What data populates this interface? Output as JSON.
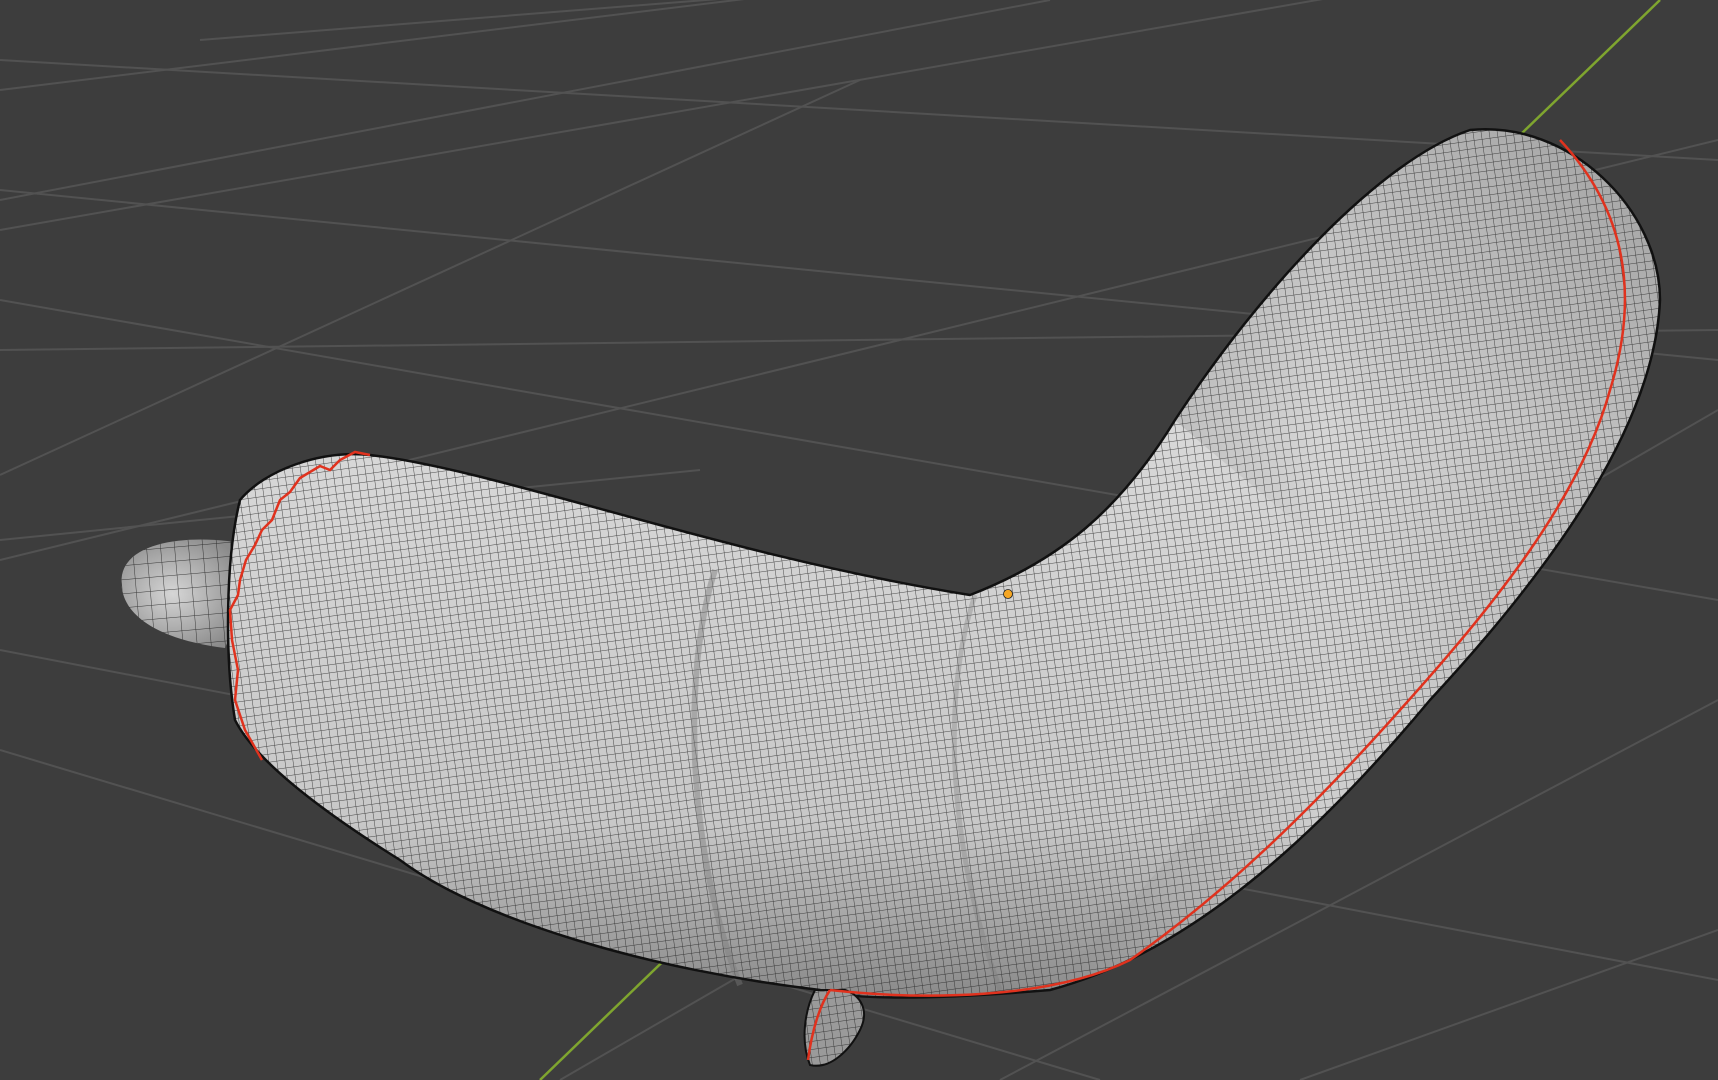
{
  "app": {
    "name": "",
    "view": "3D Viewport"
  },
  "viewport": {
    "background_color": "#3d3d3d",
    "grid_color": "#525252",
    "grid_axis_y_color": "#7fa52f",
    "show_grid": true
  },
  "mesh": {
    "object": "banana",
    "display_mode": "wireframe-on-shaded",
    "surface_color": "#c8c8c8",
    "wire_color": "#1a1a1a",
    "seam_color": "#e0321e",
    "selected": true
  },
  "origin_point": {
    "color": "#f5a623"
  }
}
